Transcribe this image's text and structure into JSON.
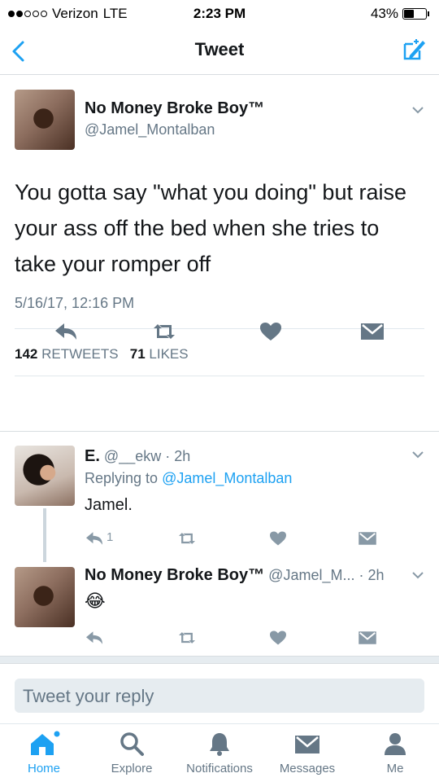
{
  "status_bar": {
    "carrier": "Verizon",
    "network": "LTE",
    "time": "2:23 PM",
    "battery": "43%",
    "battery_level": 0.43
  },
  "nav": {
    "title": "Tweet",
    "back_icon": "chevron-left-icon",
    "compose_icon": "compose-tweet-icon"
  },
  "tweet": {
    "display_name": "No Money Broke Boy™",
    "handle": "@Jamel_Montalban",
    "text": "You gotta say \"what you doing\" but raise your ass off the bed when she tries to take your romper off",
    "timestamp": "5/16/17, 12:16 PM",
    "retweets_count": "142",
    "retweets_label": "RETWEETS",
    "likes_count": "71",
    "likes_label": "LIKES"
  },
  "replies": [
    {
      "display_name": "E.",
      "handle": "@__ekw",
      "time": "· 2h",
      "replying_prefix": "Replying to",
      "replying_to": "@Jamel_Montalban",
      "text": "Jamel.",
      "reply_count": "1"
    },
    {
      "display_name": "No Money Broke Boy™",
      "handle": "@Jamel_M...",
      "time": "· 2h",
      "text": "😂"
    }
  ],
  "reply_input": {
    "placeholder": "Tweet your reply"
  },
  "tabs": [
    {
      "label": "Home",
      "icon": "home-icon"
    },
    {
      "label": "Explore",
      "icon": "search-icon"
    },
    {
      "label": "Notifications",
      "icon": "bell-icon"
    },
    {
      "label": "Messages",
      "icon": "envelope-icon"
    },
    {
      "label": "Me",
      "icon": "person-icon"
    }
  ],
  "colors": {
    "accent": "#1da1f2",
    "secondary_text": "#657786",
    "icon_gray": "#8899a6",
    "icon_dark": "#657786"
  }
}
